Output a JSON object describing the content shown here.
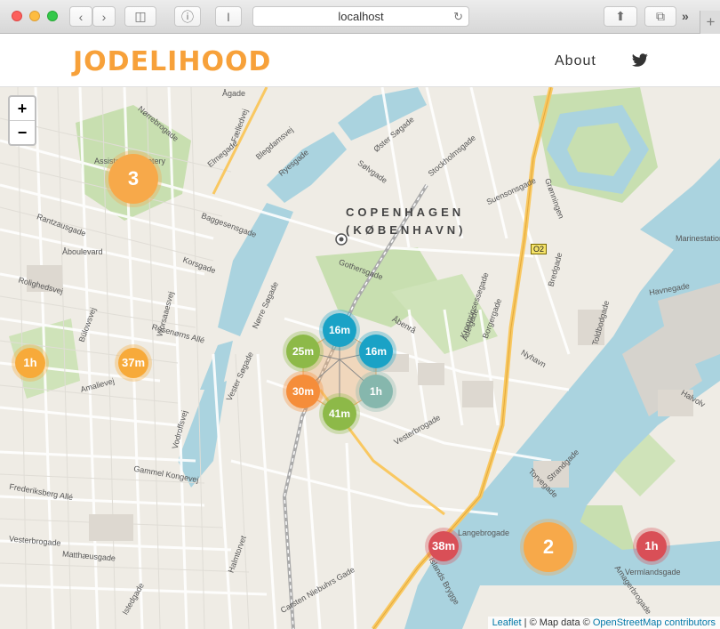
{
  "browser": {
    "url": "localhost"
  },
  "site": {
    "logo_text": "JODELIHOOD",
    "nav_about": "About",
    "twitter_icon": "twitter-icon"
  },
  "map": {
    "city_name_line1": "COPENHAGEN",
    "city_name_line2": "(KØBENHAVN)",
    "zoom_in": "+",
    "zoom_out": "−",
    "metro_label": "O2",
    "attribution_leaflet": "Leaflet",
    "attribution_separator": " | © Map data © ",
    "attribution_osm": "OpenStreetMap contributors",
    "street_labels": [
      "Assistens Cemetery",
      "Nørrebrogade",
      "Ågade",
      "Rantzausgade",
      "Åboulevard",
      "Rolighedsvej",
      "Bülowsvej",
      "Amalievej",
      "Gothersgade",
      "Vesterbrogade",
      "Gammel Kongevej",
      "Frederiksberg Allé",
      "Vesterbrogade",
      "Matthæusgade",
      "Istedgade",
      "Halmtorvet",
      "Carsten Niebuhrs Gade",
      "Langebrogade",
      "Vermlandsgade",
      "Grønningen",
      "Bredgade",
      "Toldbodgade",
      "Nyhavn",
      "Strandgade",
      "Torvegade",
      "Islands Brygge",
      "Amagerbrogade",
      "Marinestation Holmen",
      "Havnegade",
      "Kronprinsessegade",
      "Borgergade",
      "Adelgade",
      "Åbenrå",
      "Vester Søgade",
      "Nørre Søgade",
      "Rosenørns Allé",
      "Worsaaesvej",
      "Vodroffsvej",
      "Øster Søgade",
      "Sølvgade",
      "Stockholmsgade",
      "Suensonsgade",
      "Fælledvej",
      "Elmegade",
      "Baggesensgade",
      "Korsgade",
      "Blegdamsvej",
      "Ryesgade",
      "Halvolv"
    ],
    "markers": [
      {
        "label": "3",
        "color": "#f7a94a",
        "size": "big"
      },
      {
        "label": "2",
        "color": "#f7a94a",
        "size": "big"
      },
      {
        "label": "1h",
        "color": "#f7aa3a",
        "size": "small"
      },
      {
        "label": "37m",
        "color": "#f7aa3a",
        "size": "small"
      },
      {
        "label": "16m",
        "color": "#1aa2c6",
        "size": "small"
      },
      {
        "label": "16m",
        "color": "#1aa2c6",
        "size": "small"
      },
      {
        "label": "25m",
        "color": "#8db948",
        "size": "small"
      },
      {
        "label": "1h",
        "color": "#86b7ad",
        "size": "small"
      },
      {
        "label": "30m",
        "color": "#f58d3a",
        "size": "small"
      },
      {
        "label": "41m",
        "color": "#8db948",
        "size": "small"
      },
      {
        "label": "38m",
        "color": "#d94f57",
        "size": "small"
      },
      {
        "label": "1h",
        "color": "#d94f57",
        "size": "small"
      }
    ]
  }
}
